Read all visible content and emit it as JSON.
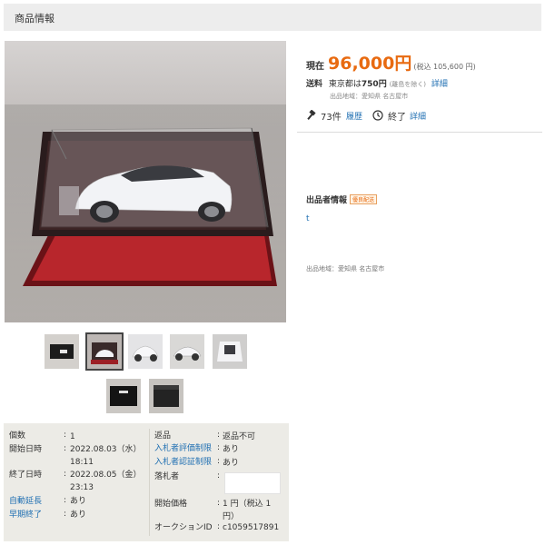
{
  "header": {
    "title": "商品情報"
  },
  "images": {
    "main_alt": "1/18 scale white sports car model in acrylic display case on red-lined base",
    "thumbnails": [
      {
        "name": "box"
      },
      {
        "name": "car-in-case"
      },
      {
        "name": "car-front"
      },
      {
        "name": "car-side"
      },
      {
        "name": "car-top"
      },
      {
        "name": "box-lid"
      },
      {
        "name": "box-dark"
      }
    ]
  },
  "price": {
    "label": "現在",
    "value": "96,000円",
    "tax_note": "(税込 105,600 円)"
  },
  "shipping": {
    "label": "送料",
    "prefix": "東京都は",
    "amount": "750円",
    "note": "(離島を除く)",
    "detail_link": "詳細",
    "origin": "出品地域：愛知県 名古屋市"
  },
  "stats": {
    "bids": "73件",
    "history_link": "履歴",
    "status": "終了",
    "detail_link": "詳細"
  },
  "seller": {
    "heading": "出品者情報",
    "badge": "優良配送",
    "name": "t",
    "region": "出品地域：愛知県 名古屋市"
  },
  "details": {
    "left": [
      {
        "label": "個数",
        "value": "1",
        "link": false
      },
      {
        "label": "開始日時",
        "value": "2022.08.03（水）18:11",
        "link": false
      },
      {
        "label": "終了日時",
        "value": "2022.08.05（金）23:13",
        "link": false
      },
      {
        "label": "自動延長",
        "value": "あり",
        "link": true
      },
      {
        "label": "早期終了",
        "value": "あり",
        "link": true
      }
    ],
    "right": [
      {
        "label": "返品",
        "value": "返品不可",
        "link": false
      },
      {
        "label": "入札者評価制限",
        "value": "あり",
        "link": true
      },
      {
        "label": "入札者認証制限",
        "value": "あり",
        "link": true
      },
      {
        "label": "落札者",
        "value": "",
        "link": false
      },
      {
        "label": "開始価格",
        "value": "1 円（税込 1 円）",
        "link": false
      },
      {
        "label": "オークションID",
        "value": "c1059517891",
        "link": false
      }
    ],
    "separator": ":"
  },
  "colors": {
    "accent": "#e86a10",
    "link": "#1f6fb2",
    "info_bg": "#ecebe6"
  }
}
